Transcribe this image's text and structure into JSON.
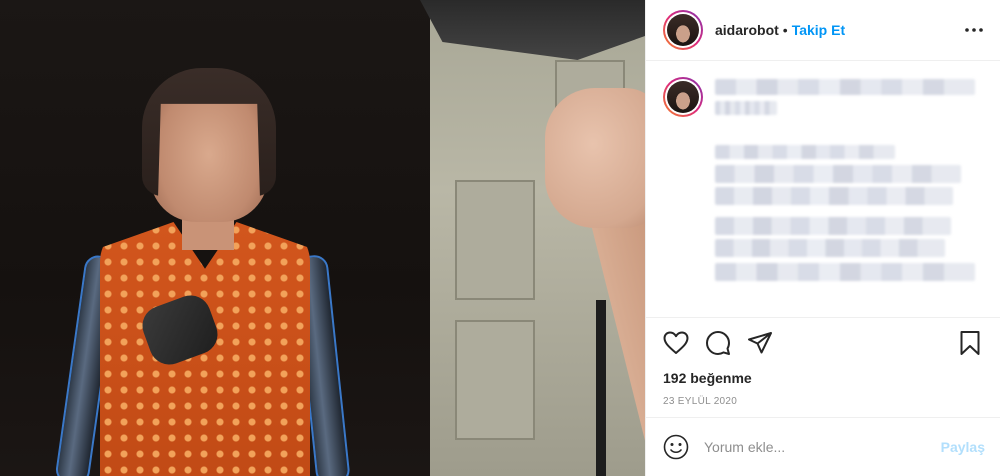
{
  "header": {
    "username": "aidarobot",
    "separator": "•",
    "follow_label": "Takip Et"
  },
  "post": {
    "likes_text": "192 beğenme",
    "date_text": "23 EYLÜL 2020"
  },
  "comment_box": {
    "placeholder": "Yorum ekle...",
    "post_label": "Paylaş"
  },
  "icons": {
    "more": "more-horizontal-icon",
    "like": "heart-icon",
    "comment": "comment-bubble-icon",
    "share": "paper-plane-icon",
    "save": "bookmark-icon",
    "emoji": "emoji-icon"
  },
  "colors": {
    "link_blue": "#0095f6",
    "post_disabled": "#b2dffc",
    "muted_text": "#8e8e8e",
    "border": "#efefef"
  }
}
